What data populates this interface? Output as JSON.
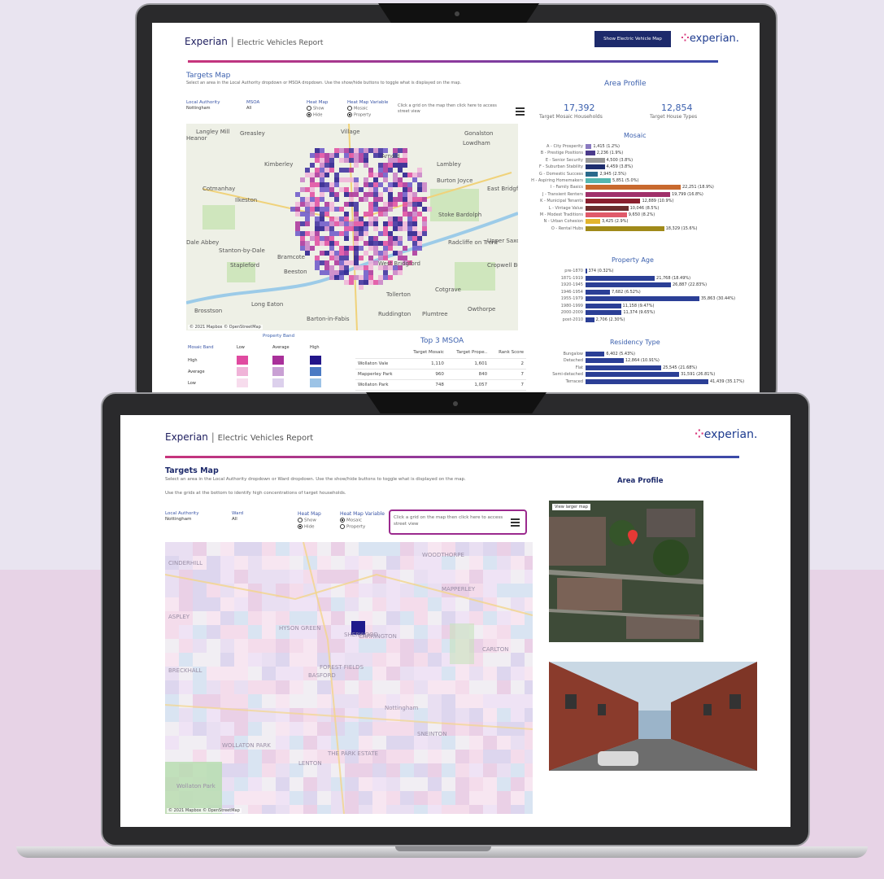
{
  "back": {
    "brand": "Experian",
    "subtitle": "Electric Vehicles Report",
    "show_ev_button": "Show Electric Vehicle Map",
    "logo_text": "experian.",
    "targets_title": "Targets Map",
    "instructions": "Select an area in the Local Authority dropdown or MSOA dropdown. Use the show/hide buttons to toggle what is displayed on the map.",
    "filters": {
      "local_authority_label": "Local Authority",
      "local_authority_value": "Nottingham",
      "msoa_label": "MSOA",
      "msoa_value": "All",
      "heat_map_label": "Heat Map",
      "heat_show": "Show",
      "heat_hide": "Hide",
      "variable_label": "Heat Map Variable",
      "var_mosaic": "Mosaic",
      "var_property": "Property",
      "street_hint": "Click a grid on the map then click here to access street view"
    },
    "map_places": [
      "Langley Mill",
      "Heanor",
      "Greasley",
      "Kimberley",
      "Arnold",
      "Lambley",
      "Burton Joyce",
      "Ilkeston",
      "Cotmanhay",
      "Stoke Bardolph",
      "Dale Abbey",
      "Stanton-by-Dale",
      "Stapleford",
      "Beeston",
      "Bramcote",
      "West Bridgford",
      "Cotgrave",
      "Long Eaton",
      "Brosstson",
      "Ruddington",
      "Plumtree",
      "Barton-in-Fabis",
      "Gonalston",
      "Lowdham",
      "Upper Saxondale",
      "Cropwell Butler",
      "Radcliffe on Trent",
      "East Bridgford",
      "Tollerton",
      "Owthorpe",
      "Village"
    ],
    "map_attr": "© 2021 Mapbox © OpenStreetMap",
    "area_profile_title": "Area Profile",
    "kpi": [
      {
        "value": "17,392",
        "label": "Target Mosaic Households"
      },
      {
        "value": "12,854",
        "label": "Target House Types"
      }
    ],
    "mosaic_title": "Mosaic",
    "mosaic_bars": [
      {
        "label": "A - City Prosperity",
        "text": "1,415 (1.2%)",
        "pct": 1.2,
        "color": "#8a7ac0"
      },
      {
        "label": "B - Prestige Positions",
        "text": "2,236 (1.9%)",
        "pct": 1.9,
        "color": "#4b3b8c"
      },
      {
        "label": "E - Senior Security",
        "text": "4,500 (3.8%)",
        "pct": 3.8,
        "color": "#9a9a9a"
      },
      {
        "label": "F - Suburban Stability",
        "text": "4,459 (3.8%)",
        "pct": 3.8,
        "color": "#1e2e6e"
      },
      {
        "label": "G - Domestic Success",
        "text": "2,945 (2.5%)",
        "pct": 2.5,
        "color": "#2a6a8c"
      },
      {
        "label": "H - Aspiring Homemakers",
        "text": "5,851 (5.0%)",
        "pct": 5.0,
        "color": "#55b7b0"
      },
      {
        "label": "I - Family Basics",
        "text": "22,251 (18.9%)",
        "pct": 18.9,
        "color": "#c8692e"
      },
      {
        "label": "J - Transient Renters",
        "text": "19,799 (16.8%)",
        "pct": 16.8,
        "color": "#a0306a"
      },
      {
        "label": "K - Municipal Tenants",
        "text": "12,889 (10.9%)",
        "pct": 10.9,
        "color": "#8a1f2e"
      },
      {
        "label": "L - Vintage Value",
        "text": "10,046 (8.5%)",
        "pct": 8.5,
        "color": "#6b2d2d"
      },
      {
        "label": "M - Modest Traditions",
        "text": "9,650 (8.2%)",
        "pct": 8.2,
        "color": "#e05a6a"
      },
      {
        "label": "N - Urban Cohesion",
        "text": "3,425 (2.9%)",
        "pct": 2.9,
        "color": "#e3b52e"
      },
      {
        "label": "O - Rental Hubs",
        "text": "18,329 (15.6%)",
        "pct": 15.6,
        "color": "#a08a1a"
      }
    ],
    "property_age_title": "Property Age",
    "property_age_bars": [
      {
        "label": "pre-1870",
        "text": "374 (0.32%)",
        "pct": 0.32
      },
      {
        "label": "1871-1919",
        "text": "21,768 (18.49%)",
        "pct": 18.49
      },
      {
        "label": "1920-1945",
        "text": "26,887 (22.83%)",
        "pct": 22.83
      },
      {
        "label": "1946-1954",
        "text": "7,682 (6.52%)",
        "pct": 6.52
      },
      {
        "label": "1955-1979",
        "text": "35,863 (30.44%)",
        "pct": 30.44
      },
      {
        "label": "1980-1999",
        "text": "11,158 (9.47%)",
        "pct": 9.47
      },
      {
        "label": "2000-2009",
        "text": "11,374 (9.65%)",
        "pct": 9.65
      },
      {
        "label": "post-2010",
        "text": "2,706 (2.30%)",
        "pct": 2.3
      }
    ],
    "residency_title": "Residency Type",
    "residency_bars": [
      {
        "label": "Bungalow",
        "text": "6,402 (5.43%)",
        "pct": 5.43
      },
      {
        "label": "Detached",
        "text": "12,864 (10.91%)",
        "pct": 10.91
      },
      {
        "label": "Flat",
        "text": "25,545 (21.68%)",
        "pct": 21.68
      },
      {
        "label": "Semi-detached",
        "text": "31,591 (26.81%)",
        "pct": 26.81
      },
      {
        "label": "Terraced",
        "text": "41,439 (35.17%)",
        "pct": 35.17
      }
    ],
    "property_band_title": "Property Band",
    "band_matrix": {
      "row_header": "Mosaic Band",
      "columns": [
        "Low",
        "Average",
        "High"
      ],
      "rows": [
        "High",
        "Average",
        "Low"
      ]
    },
    "top3_title": "Top 3 MSOA",
    "top3_headers": [
      "",
      "Target Mosaic",
      "Target Prope..",
      "Rank Score"
    ],
    "top3_rows": [
      [
        "Wollaton Vale",
        "1,110",
        "1,601",
        "2"
      ],
      [
        "Mapperley Park",
        "960",
        "840",
        "7"
      ],
      [
        "Wollaton Park",
        "748",
        "1,057",
        "7"
      ]
    ]
  },
  "front": {
    "brand": "Experian",
    "subtitle": "Electric Vehicles Report",
    "logo_text": "experian.",
    "targets_title": "Targets Map",
    "instructions": "Select an area in the Local Authority dropdown or Ward dropdown. Use the show/hide buttons to toggle what is displayed on the map.",
    "instructions2": "Use the grids at the bottom to identify high concentrations of target households.",
    "filters": {
      "local_authority_label": "Local Authority",
      "local_authority_value": "Nottingham",
      "ward_label": "Ward",
      "ward_value": "All",
      "heat_map_label": "Heat Map",
      "heat_show": "Show",
      "heat_hide": "Hide",
      "variable_label": "Heat Map Variable",
      "var_mosaic": "Mosaic",
      "var_property": "Property",
      "street_hint": "Click a grid on the map then click here to access street view"
    },
    "map_places": [
      "WOODTHORPE",
      "CINDERHILL",
      "MAPPERLEY",
      "ASPLEY",
      "BRECKHALL",
      "BASFORD",
      "CARLTON",
      "Nottingham",
      "SNEINTON",
      "WOLLATON PARK",
      "LENTON",
      "THE PARK ESTATE",
      "FOREST FIELDS",
      "HYSON GREEN",
      "Wollaton Park",
      "SHERWOOD",
      "CARRINGTON"
    ],
    "map_attr": "© 2021 Mapbox © OpenStreetMap",
    "area_profile_title": "Area Profile",
    "view_larger_map": "View larger map"
  },
  "colors": {
    "navy": "#1d2a6b",
    "brand_blue": "#1d3b8f",
    "brand_pink": "#d8367a",
    "highlight": "#9b2a8e",
    "bar_blue": "#2b3f96"
  }
}
